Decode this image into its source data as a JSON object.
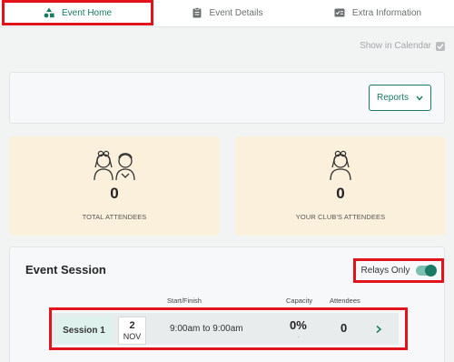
{
  "tabs": [
    {
      "label": "Event Home",
      "icon": "shapes-icon",
      "active": true
    },
    {
      "label": "Event Details",
      "icon": "clipboard-icon",
      "active": false
    },
    {
      "label": "Extra Information",
      "icon": "info-card-icon",
      "active": false
    }
  ],
  "show_in_calendar": {
    "label": "Show in Calendar",
    "checked": true
  },
  "reports": {
    "label": "Reports"
  },
  "stats": {
    "total": {
      "value": "0",
      "label": "TOTAL ATTENDEES"
    },
    "club": {
      "value": "0",
      "label": "YOUR CLUB'S ATTENDEES"
    }
  },
  "session_section": {
    "title": "Event Session",
    "relays_label": "Relays Only",
    "relays_on": true,
    "headers": {
      "start_finish": "Start/Finish",
      "capacity": "Capacity",
      "attendees": "Attendees"
    },
    "sessions": [
      {
        "name": "Session 1",
        "day": "2",
        "month": "NOV",
        "time": "9:00am to 9:00am",
        "capacity": "0%",
        "capacity_sub": "-",
        "attendees": "0"
      }
    ]
  },
  "colors": {
    "accent": "#1a7a63",
    "highlight": "#e3131b",
    "stat_bg": "#fbf0dc"
  }
}
